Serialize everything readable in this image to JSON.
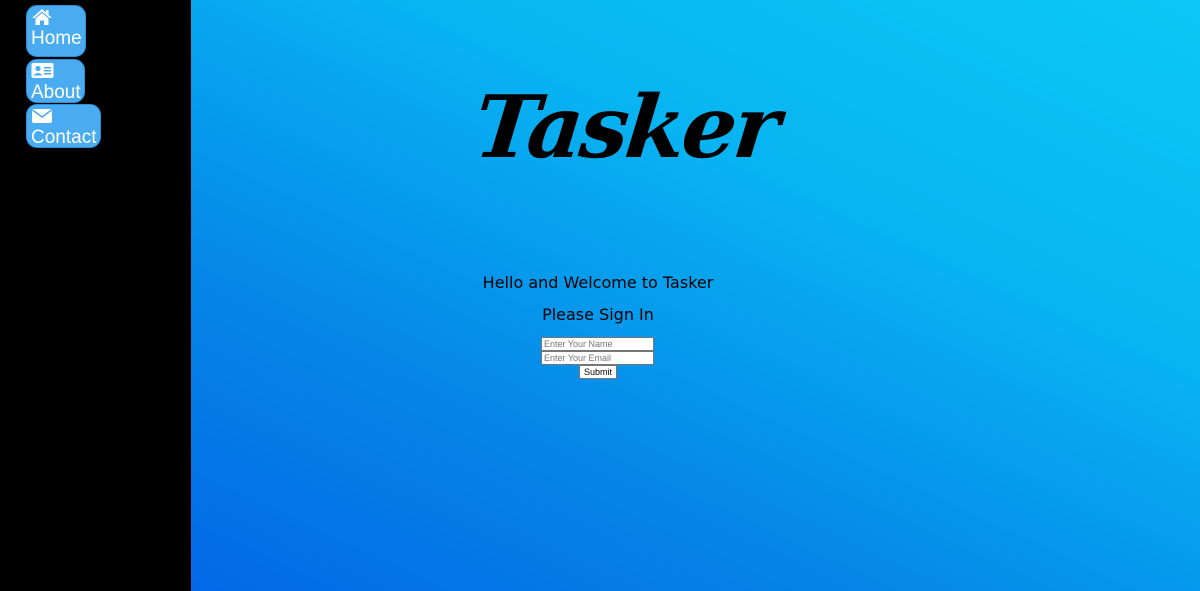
{
  "sidebar": {
    "items": [
      {
        "label": "Home",
        "icon": "home-icon"
      },
      {
        "label": "About",
        "icon": "id-card-icon"
      },
      {
        "label": "Contact",
        "icon": "envelope-icon"
      }
    ]
  },
  "main": {
    "logo": "Tasker",
    "welcome": "Hello and Welcome to Tasker",
    "signin": "Please Sign In",
    "form": {
      "name_placeholder": "Enter Your Name",
      "email_placeholder": "Enter Your Email",
      "submit_label": "Submit"
    }
  },
  "colors": {
    "sidebar_bg": "#000000",
    "nav_button_bg": "#4aacf0",
    "gradient_top": "#0cc8f7",
    "gradient_bottom": "#0468e6"
  }
}
